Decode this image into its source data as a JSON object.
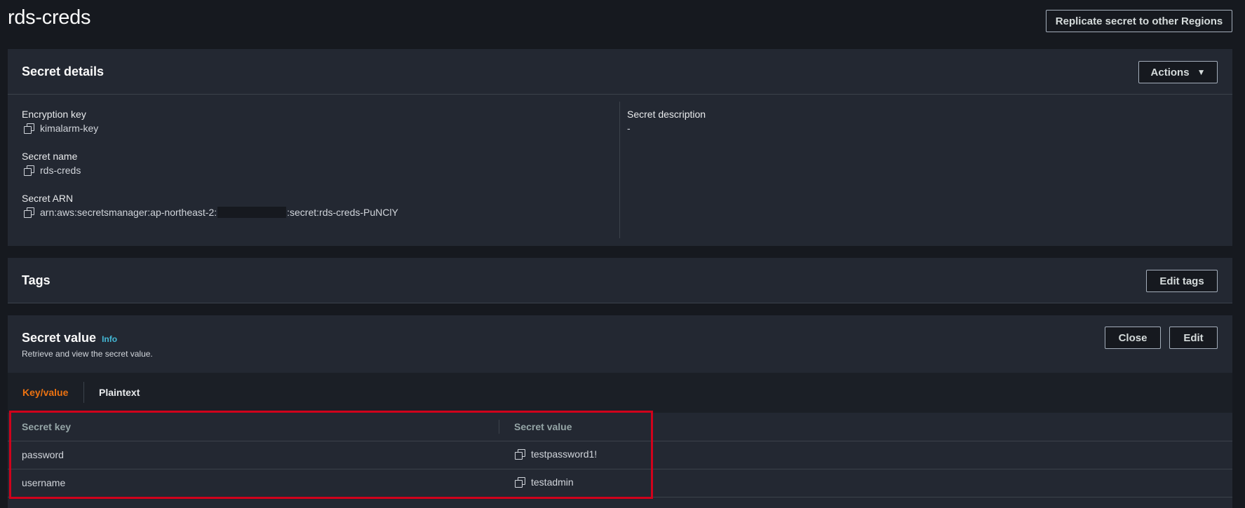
{
  "page": {
    "title": "rds-creds",
    "replicate_button": "Replicate secret to other Regions"
  },
  "secret_details": {
    "title": "Secret details",
    "actions_button": "Actions",
    "encryption_key": {
      "label": "Encryption key",
      "value": "kimalarm-key"
    },
    "secret_name": {
      "label": "Secret name",
      "value": "rds-creds"
    },
    "secret_arn": {
      "label": "Secret ARN",
      "value_prefix": "arn:aws:secretsmanager:ap-northeast-2:",
      "value_suffix": ":secret:rds-creds-PuNClY"
    },
    "secret_description": {
      "label": "Secret description",
      "value": "-"
    }
  },
  "tags": {
    "title": "Tags",
    "edit_button": "Edit tags"
  },
  "secret_value": {
    "title": "Secret value",
    "info_link": "Info",
    "subtitle": "Retrieve and view the secret value.",
    "close_button": "Close",
    "edit_button": "Edit",
    "tabs": [
      {
        "label": "Key/value",
        "active": true
      },
      {
        "label": "Plaintext",
        "active": false
      }
    ],
    "table": {
      "columns": [
        "Secret key",
        "Secret value"
      ],
      "rows": [
        {
          "key": "password",
          "value": "testpassword1!"
        },
        {
          "key": "username",
          "value": "testadmin"
        }
      ]
    }
  },
  "colors": {
    "background": "#16191f",
    "panel": "#232832",
    "active_tab": "#ec7211",
    "info_link": "#44b9d6",
    "highlight": "#d0021b"
  }
}
